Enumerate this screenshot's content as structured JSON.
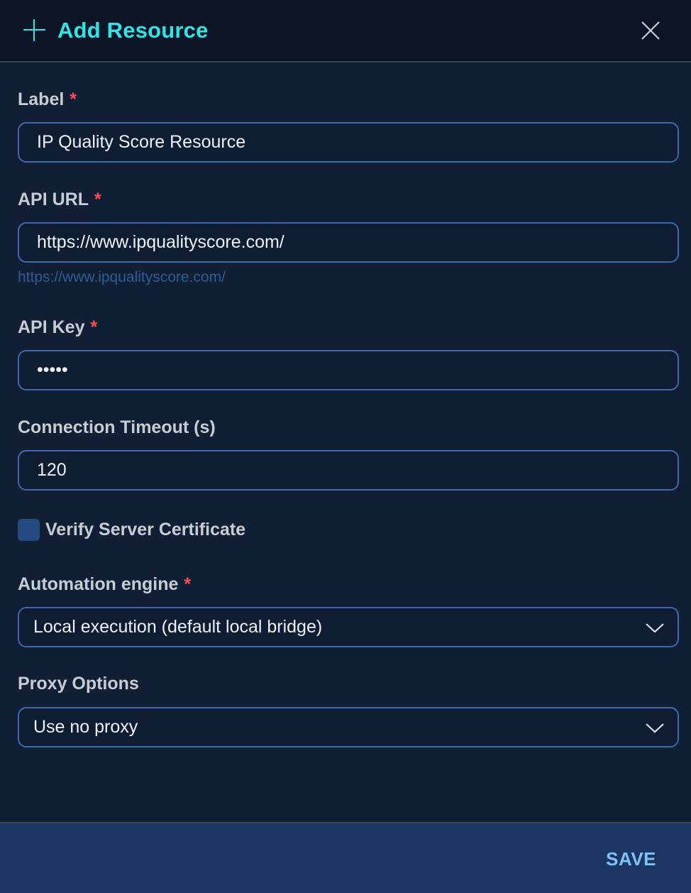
{
  "dialog": {
    "title": "Add Resource",
    "icon": "plus-icon",
    "close_icon": "close-icon"
  },
  "form": {
    "label": {
      "text": "Label",
      "required_mark": "*",
      "value": "IP Quality Score Resource"
    },
    "api_url": {
      "text": "API URL",
      "required_mark": "*",
      "value": "https://www.ipqualityscore.com/",
      "helper": "https://www.ipqualityscore.com/"
    },
    "api_key": {
      "text": "API Key",
      "required_mark": "*",
      "value": "•••••"
    },
    "timeout": {
      "text": "Connection Timeout (s)",
      "value": "120"
    },
    "verify_cert": {
      "text": "Verify Server Certificate",
      "checked": false
    },
    "engine": {
      "text": "Automation engine",
      "required_mark": "*",
      "value": "Local execution (default local bridge)"
    },
    "proxy": {
      "text": "Proxy Options",
      "value": "Use no proxy"
    }
  },
  "footer": {
    "save_label": "SAVE"
  },
  "colors": {
    "accent": "#2ee6e6",
    "required": "#ff4d4d",
    "border": "#3d6ab0",
    "save": "#7fc3f5"
  }
}
